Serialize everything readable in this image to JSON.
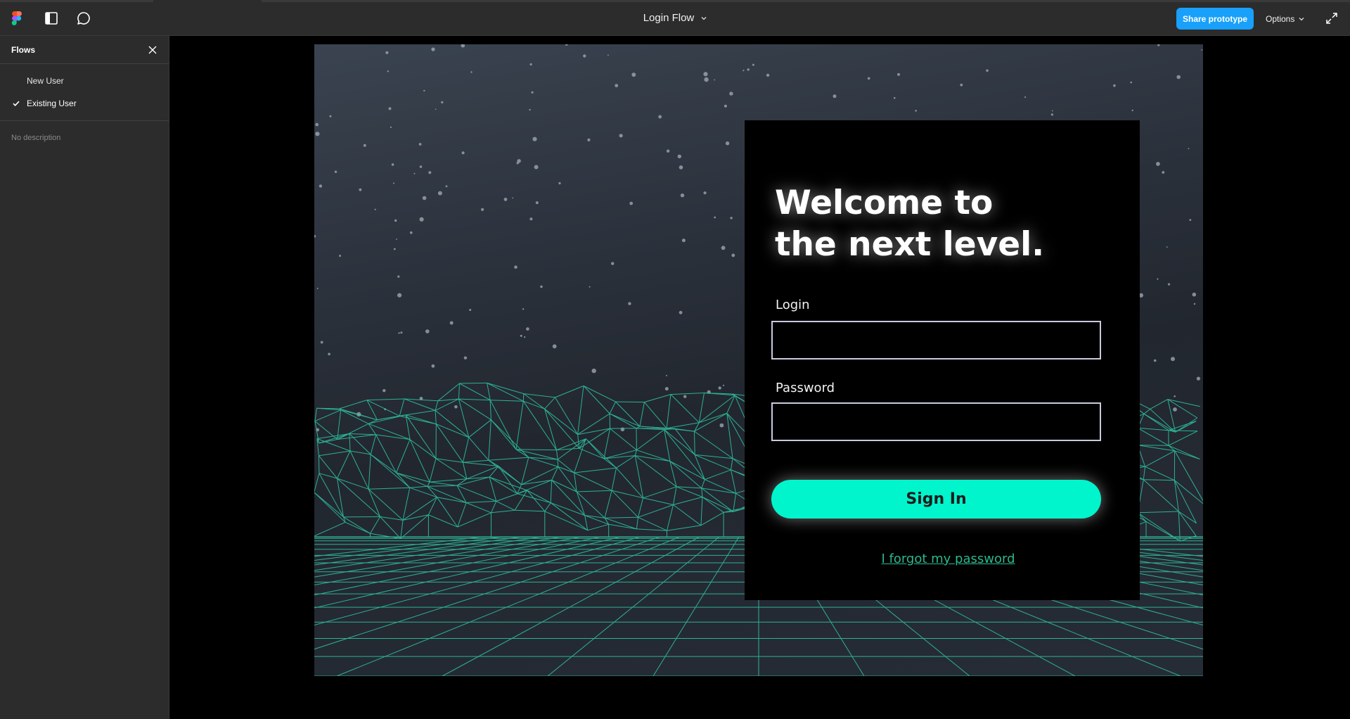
{
  "topbar": {
    "title": "Login Flow",
    "share_label": "Share prototype",
    "options_label": "Options",
    "icons": [
      "figma-logo-icon",
      "sidebar-toggle-icon",
      "comment-icon",
      "chevron-down-icon",
      "expand-icon"
    ]
  },
  "sidebar": {
    "title": "Flows",
    "items": [
      {
        "label": "New User",
        "selected": false
      },
      {
        "label": "Existing User",
        "selected": true
      }
    ],
    "description": "No description"
  },
  "prototype": {
    "headline": "Welcome to\nthe next level.",
    "login_label": "Login",
    "login_value": "",
    "password_label": "Password",
    "password_value": "",
    "signin_label": "Sign In",
    "forgot_label": "I forgot my password"
  },
  "colors": {
    "accent": "#18a0fb",
    "signin": "#00f5cc",
    "link": "#2bb88e",
    "grid": "#2fc9a4"
  }
}
